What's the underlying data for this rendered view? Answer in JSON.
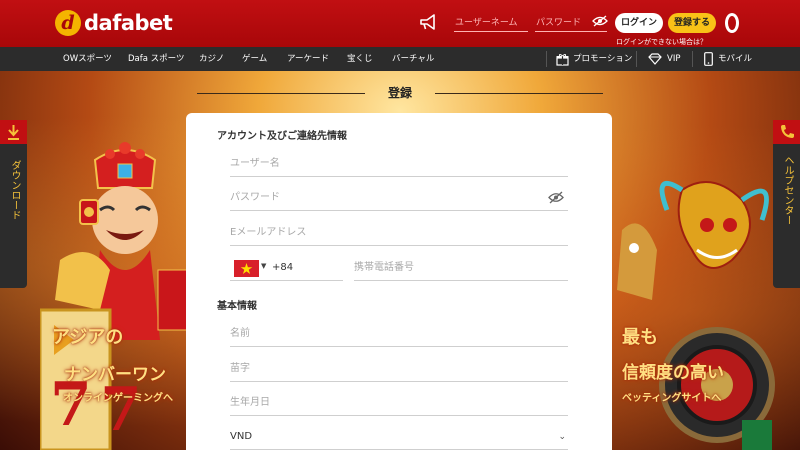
{
  "brand": {
    "name": "dafabet",
    "mark": "d"
  },
  "header": {
    "username_placeholder": "ユーザーネーム",
    "password_placeholder": "パスワード",
    "login_label": "ログイン",
    "register_label": "登録する",
    "forgot_label": "ログインができない場合は？"
  },
  "nav": {
    "items": [
      "OWスポーツ",
      "Dafa スポーツ",
      "カジノ",
      "ゲーム",
      "アーケード",
      "宝くじ",
      "バーチャル"
    ],
    "promotions": "プロモーション",
    "vip": "VIP",
    "mobile": "モバイル"
  },
  "side": {
    "download": "ダウンロード",
    "help": "ヘルプセンター"
  },
  "promo_left": {
    "line1": "アジアの",
    "line2": "ナンバーワン",
    "line3": "オンラインゲーミングへ"
  },
  "promo_right": {
    "line1": "最も",
    "line2": "信頼度の高い",
    "line3": "ベッティングサイトへ"
  },
  "page_title": "登録",
  "form": {
    "section_contact": "アカウント及びご連絡先情報",
    "username_placeholder": "ユーザー名",
    "password_placeholder": "パスワード",
    "email_placeholder": "Eメールアドレス",
    "country_code": "+84",
    "phone_placeholder": "携帯電話番号",
    "section_basic": "基本情報",
    "firstname_placeholder": "名前",
    "lastname_placeholder": "苗字",
    "dob_placeholder": "生年月日",
    "currency_value": "VND"
  },
  "colors": {
    "brand_red": "#c10f12",
    "nav_dark": "#2c2c2c",
    "accent_yellow": "#f9c217"
  }
}
